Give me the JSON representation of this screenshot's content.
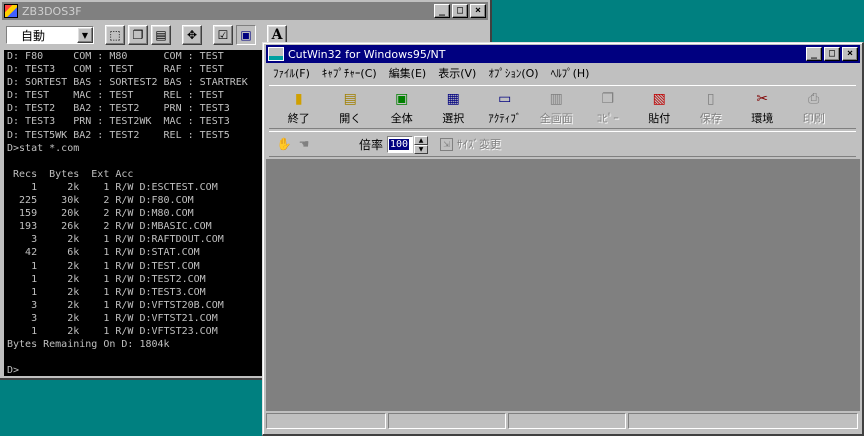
{
  "dos_window": {
    "title": "ZB3DOS3F",
    "font_select": "自動",
    "toolbar_font_button": "A",
    "screen_lines": [
      "D: F80     COM : M80      COM : TEST",
      "D: TEST3   COM : TEST     RAF : TEST",
      "D: SORTEST BAS : SORTEST2 BAS : STARTREK",
      "D: TEST    MAC : TEST     REL : TEST",
      "D: TEST2   BA2 : TEST2    PRN : TEST3",
      "D: TEST3   PRN : TEST2WK  MAC : TEST3",
      "D: TEST5WK BA2 : TEST2    REL : TEST5",
      "D>stat *.com",
      "",
      " Recs  Bytes  Ext Acc",
      "    1     2k    1 R/W D:ESCTEST.COM",
      "  225    30k    2 R/W D:F80.COM",
      "  159    20k    2 R/W D:M80.COM",
      "  193    26k    2 R/W D:MBASIC.COM",
      "    3     2k    1 R/W D:RAFTDOUT.COM",
      "   42     6k    1 R/W D:STAT.COM",
      "    1     2k    1 R/W D:TEST.COM",
      "    1     2k    1 R/W D:TEST2.COM",
      "    1     2k    1 R/W D:TEST3.COM",
      "    3     2k    1 R/W D:VFTST20B.COM",
      "    3     2k    1 R/W D:VFTST21.COM",
      "    1     2k    1 R/W D:VFTST23.COM",
      "Bytes Remaining On D: 1804k",
      "",
      "D>"
    ]
  },
  "cutwin": {
    "title": "CutWin32 for Windows95/NT",
    "menu": [
      "ﾌｧｲﾙ(F)",
      "ｷｬﾌﾟﾁｬｰ(C)",
      "編集(E)",
      "表示(V)",
      "ｵﾌﾟｼｮﾝ(O)",
      "ﾍﾙﾌﾟ(H)"
    ],
    "toolbar": [
      {
        "label": "終了",
        "icon": "exit-door-icon",
        "glyph": "▮",
        "color": "#d0a000",
        "enabled": true
      },
      {
        "label": "開く",
        "icon": "open-file-icon",
        "glyph": "▤",
        "color": "#a08000",
        "enabled": true
      },
      {
        "label": "全体",
        "icon": "monitor-icon",
        "glyph": "▣",
        "color": "#008000",
        "enabled": true
      },
      {
        "label": "選択",
        "icon": "select-region-icon",
        "glyph": "▦",
        "color": "#000080",
        "enabled": true
      },
      {
        "label": "ｱｸﾃｨﾌﾞ",
        "icon": "active-window-icon",
        "glyph": "▭",
        "color": "#000080",
        "enabled": true
      },
      {
        "label": "全画面",
        "icon": "fullscreen-icon",
        "glyph": "▥",
        "color": "#808080",
        "enabled": false
      },
      {
        "label": "ｺﾋﾟｰ",
        "icon": "copy-icon",
        "glyph": "❐",
        "color": "#808080",
        "enabled": false
      },
      {
        "label": "貼付",
        "icon": "paste-icon",
        "glyph": "▧",
        "color": "#c00000",
        "enabled": true
      },
      {
        "label": "保存",
        "icon": "save-disk-icon",
        "glyph": "▯",
        "color": "#808080",
        "enabled": false
      },
      {
        "label": "環境",
        "icon": "settings-tools-icon",
        "glyph": "✂",
        "color": "#800000",
        "enabled": true
      },
      {
        "label": "印刷",
        "icon": "printer-icon",
        "glyph": "⎙",
        "color": "#808080",
        "enabled": false
      }
    ],
    "zoom_label": "倍率",
    "zoom_value": "100",
    "size_change_label": "ｻｲｽﾞ変更"
  }
}
